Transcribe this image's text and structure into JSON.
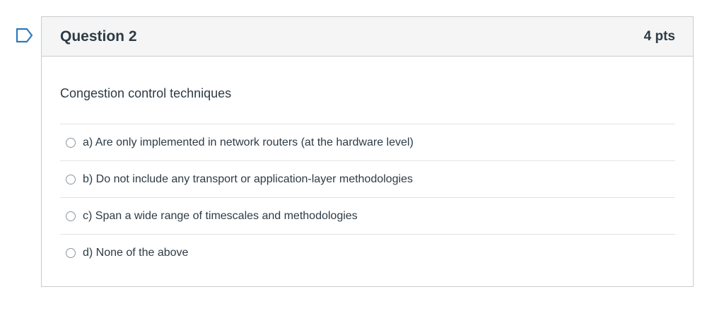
{
  "question": {
    "title": "Question 2",
    "points": "4 pts",
    "text": "Congestion control techniques",
    "answers": [
      "a) Are only implemented in network routers (at the hardware level)",
      "b) Do not include any transport or application-layer methodologies",
      "c) Span a wide range of timescales and methodologies",
      "d) None of the above"
    ],
    "flagged": false
  },
  "icons": {
    "flag": "flag-outline-icon"
  },
  "colors": {
    "flag": "#2b7abc",
    "text": "#2d3b45",
    "border": "#c7cdd1",
    "header_bg": "#f5f5f5"
  }
}
